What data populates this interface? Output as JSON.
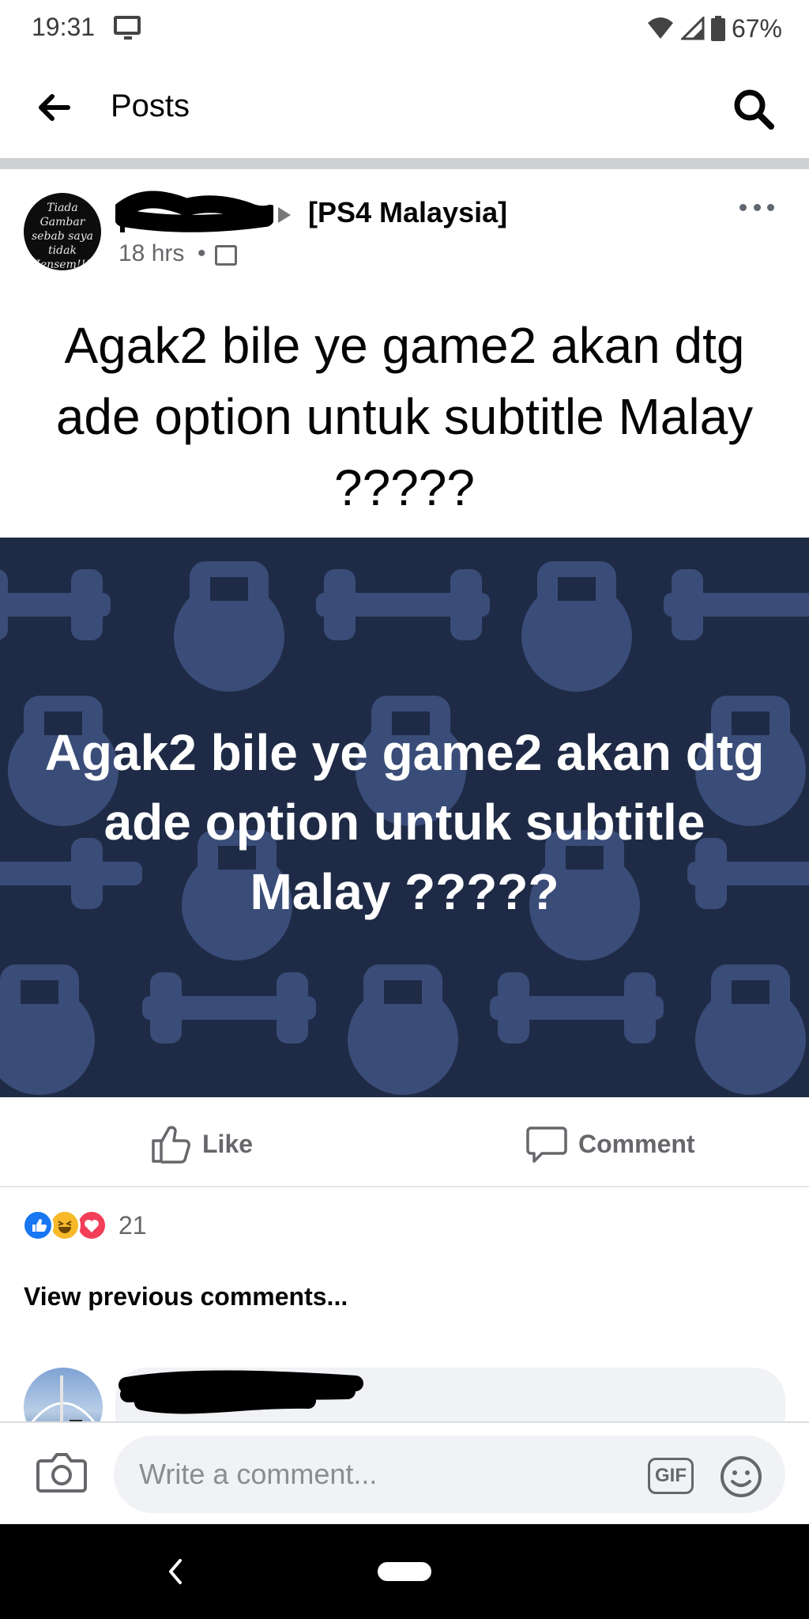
{
  "status_bar": {
    "time": "19:31",
    "battery": "67%",
    "icons": [
      "screen-cast-icon",
      "wifi-icon",
      "signal-icon",
      "battery-icon"
    ]
  },
  "header": {
    "title": "Posts",
    "back_icon": "back-arrow-icon",
    "search_icon": "search-icon"
  },
  "post": {
    "author_redacted": true,
    "group": "[PS4 Malaysia]",
    "time": "18 hrs",
    "separator": "•",
    "audience_icon": "group-audience-icon",
    "avatar_text": "Tiada Gambar sebab saya tidak Hensem!!!!",
    "text": "Agak2 bile ye game2 akan dtg ade option untuk subtitle Malay ?????",
    "image_text": "Agak2 bile ye game2 akan dtg ade option untuk subtitle Malay ?????",
    "image_bg_color": "#1f2b46",
    "image_pattern_color": "#3a4c78"
  },
  "actions": {
    "like": "Like",
    "comment": "Comment"
  },
  "reactions": {
    "types": [
      "like",
      "haha",
      "love"
    ],
    "count": "21"
  },
  "comments": {
    "view_previous": "View previous comments..."
  },
  "composer": {
    "placeholder": "Write a comment...",
    "gif_label": "GIF"
  }
}
